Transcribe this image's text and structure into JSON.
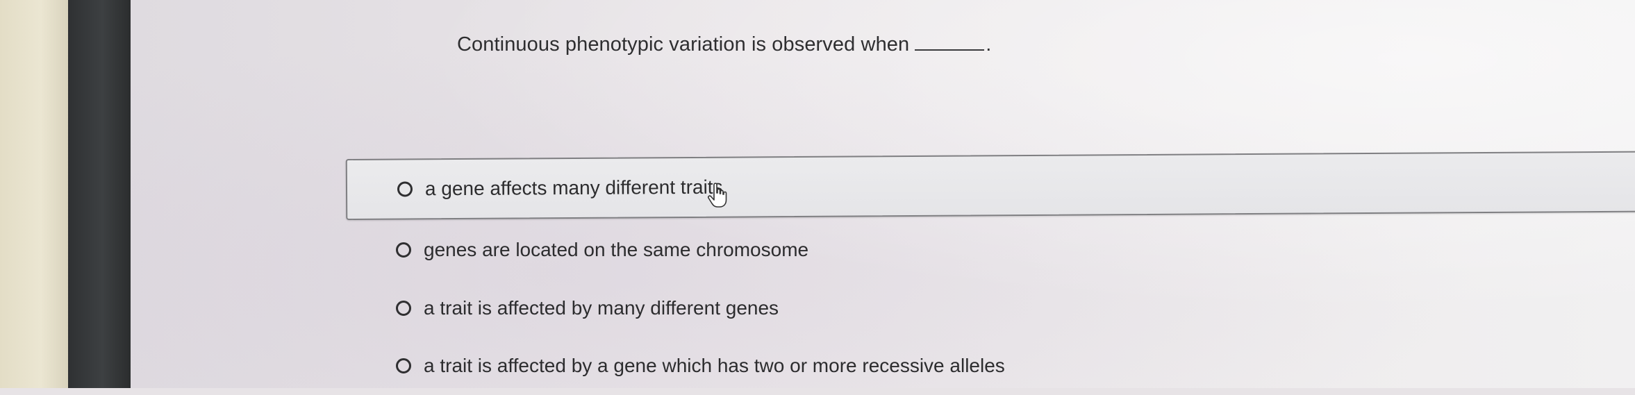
{
  "question": {
    "text": "Continuous phenotypic variation is observed when",
    "end_mark": "."
  },
  "options": [
    {
      "label": "a gene affects many different traits",
      "highlighted": true,
      "selected": false
    },
    {
      "label": "genes are located on the same chromosome",
      "highlighted": false,
      "selected": false
    },
    {
      "label": "a trait is affected by many different genes",
      "highlighted": false,
      "selected": false
    },
    {
      "label": "a trait is affected by a gene which has two or more recessive alleles",
      "highlighted": false,
      "selected": false
    }
  ],
  "cursor": {
    "icon": "hand-pointer-icon"
  }
}
